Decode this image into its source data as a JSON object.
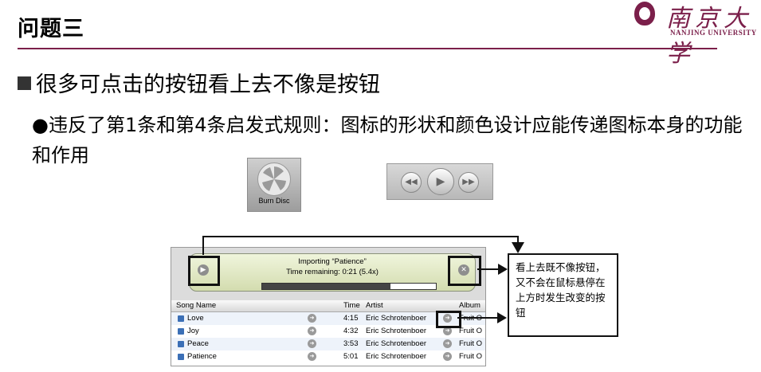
{
  "title": "问题三",
  "logo": {
    "chinese": "南京大学",
    "english": "NANJING UNIVERSITY"
  },
  "bullet1": "很多可点击的按钮看上去不像是按钮",
  "bullet2": "●违反了第1条和第4条启发式规则：图标的形状和颜色设计应能传递图标本身的功能和作用",
  "burn_disc": {
    "label": "Burn Disc",
    "icon": "burn-disc-icon"
  },
  "transport": {
    "prev": "◀◀",
    "play": "▶",
    "next": "▶▶"
  },
  "itunes": {
    "line1": "Importing “Patience”",
    "line2": "Time remaining: 0:21 (5.4x)",
    "progress": 0.74,
    "columns": [
      "Song Name",
      "Time",
      "Artist",
      "Album"
    ],
    "rows": [
      {
        "song": "Love",
        "time": "4:15",
        "artist": "Eric Schrotenboer",
        "album": "Fruit O"
      },
      {
        "song": "Joy",
        "time": "4:32",
        "artist": "Eric Schrotenboer",
        "album": "Fruit O"
      },
      {
        "song": "Peace",
        "time": "3:53",
        "artist": "Eric Schrotenboer",
        "album": "Fruit O"
      },
      {
        "song": "Patience",
        "time": "5:01",
        "artist": "Eric Schrotenboer",
        "album": "Fruit O"
      }
    ]
  },
  "callout": "看上去既不像按钮，又不会在鼠标悬停在上方时发生改变的按钮",
  "colors": {
    "accent": "#7b1f4a",
    "lcd": "#d3dcaf"
  }
}
